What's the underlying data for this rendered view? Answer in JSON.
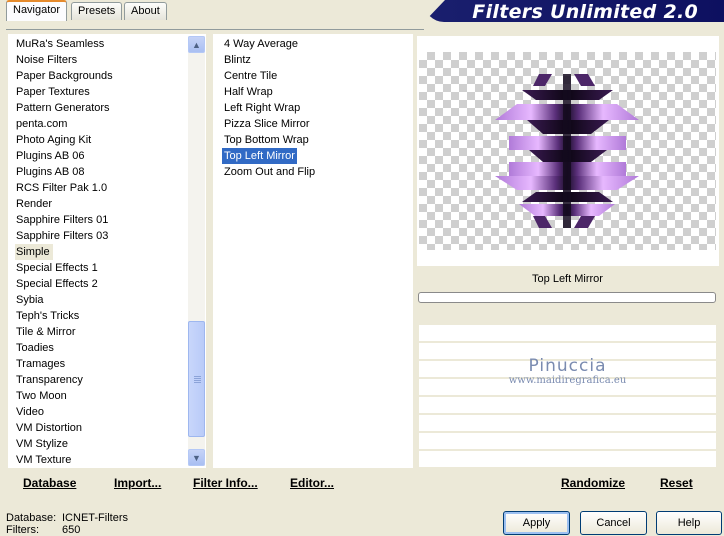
{
  "tabs": [
    "Navigator",
    "Presets",
    "About"
  ],
  "banner_title": "Filters Unlimited 2.0",
  "categories": [
    "MuRa's Seamless",
    "Noise Filters",
    "Paper Backgrounds",
    "Paper Textures",
    "Pattern Generators",
    "penta.com",
    "Photo Aging Kit",
    "Plugins AB 06",
    "Plugins AB 08",
    "RCS Filter Pak 1.0",
    "Render",
    "Sapphire Filters 01",
    "Sapphire Filters 03",
    "Simple",
    "Special Effects 1",
    "Special Effects 2",
    "Sybia",
    "Teph's Tricks",
    "Tile & Mirror",
    "Toadies",
    "Tramages",
    "Transparency",
    "Two Moon",
    "Video",
    "VM Distortion",
    "VM Stylize",
    "VM Texture"
  ],
  "selected_category": "Simple",
  "filters": [
    "4 Way Average",
    "Blintz",
    "Centre Tile",
    "Half Wrap",
    "Left Right Wrap",
    "Pizza Slice Mirror",
    "Top Bottom Wrap",
    "Top Left Mirror",
    "Zoom Out and Flip"
  ],
  "selected_filter": "Top Left Mirror",
  "preview_filter_name": "Top Left Mirror",
  "watermark": {
    "name": "Pinuccia",
    "url": "www.maidiregrafica.eu"
  },
  "bottom_left": {
    "database": "Database",
    "import": "Import...",
    "filter_info": "Filter Info...",
    "editor": "Editor..."
  },
  "bottom_right": {
    "randomize": "Randomize",
    "reset": "Reset"
  },
  "info": {
    "database_label": "Database:",
    "database_value": "ICNET-Filters",
    "filters_label": "Filters:",
    "filters_value": "650"
  },
  "buttons": {
    "apply": "Apply",
    "cancel": "Cancel",
    "help": "Help"
  },
  "icons": {
    "scroll_up": "chevron-up-icon",
    "scroll_down": "chevron-down-icon"
  }
}
